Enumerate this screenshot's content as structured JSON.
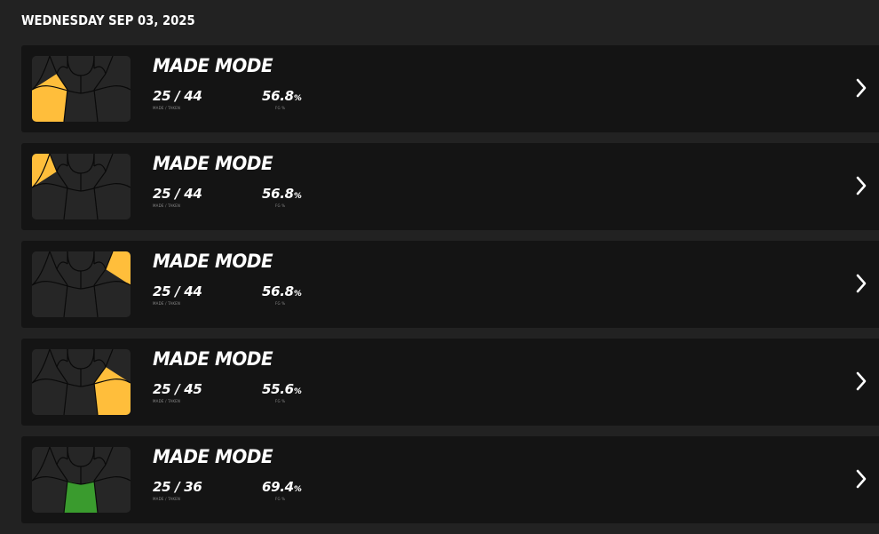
{
  "date_header": "WEDNESDAY SEP 03, 2025",
  "colors": {
    "background": "#222222",
    "card": "#141414",
    "thumb_base": "#262626",
    "highlight_yellow": "#FFBE3B",
    "highlight_green": "#3A9B2E",
    "zone_line": "#0a0a0a"
  },
  "sessions": [
    {
      "title": "MADE MODE",
      "made_taken": "25 / 44",
      "pct_value": "56.8",
      "pct_sign": "%",
      "made_label": "MADE / TAKEN",
      "pct_label": "FG %",
      "highlight_zone": "left-wing",
      "highlight_color": "#FFBE3B",
      "chevron_icon": "chevron-right-icon"
    },
    {
      "title": "MADE MODE",
      "made_taken": "25 / 44",
      "pct_value": "56.8",
      "pct_sign": "%",
      "made_label": "MADE / TAKEN",
      "pct_label": "FG %",
      "highlight_zone": "left-corner",
      "highlight_color": "#FFBE3B",
      "chevron_icon": "chevron-right-icon"
    },
    {
      "title": "MADE MODE",
      "made_taken": "25 / 44",
      "pct_value": "56.8",
      "pct_sign": "%",
      "made_label": "MADE / TAKEN",
      "pct_label": "FG %",
      "highlight_zone": "right-corner",
      "highlight_color": "#FFBE3B",
      "chevron_icon": "chevron-right-icon"
    },
    {
      "title": "MADE MODE",
      "made_taken": "25 / 45",
      "pct_value": "55.6",
      "pct_sign": "%",
      "made_label": "MADE / TAKEN",
      "pct_label": "FG %",
      "highlight_zone": "right-wing",
      "highlight_color": "#FFBE3B",
      "chevron_icon": "chevron-right-icon"
    },
    {
      "title": "MADE MODE",
      "made_taken": "25 / 36",
      "pct_value": "69.4",
      "pct_sign": "%",
      "made_label": "MADE / TAKEN",
      "pct_label": "FG %",
      "highlight_zone": "top-key",
      "highlight_color": "#3A9B2E",
      "chevron_icon": "chevron-right-icon"
    }
  ]
}
